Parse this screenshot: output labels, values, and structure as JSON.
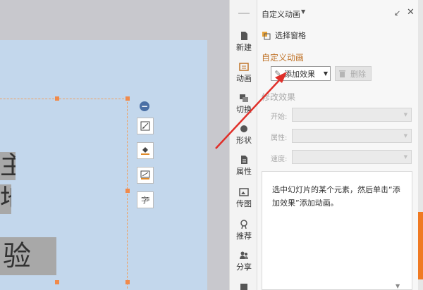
{
  "canvas": {
    "text_lines": [
      "主",
      "地",
      "验"
    ]
  },
  "toolstrip": {
    "items": [
      {
        "label": "新建",
        "icon": "new-doc-icon"
      },
      {
        "label": "动画",
        "icon": "animation-icon"
      },
      {
        "label": "切换",
        "icon": "transition-icon"
      },
      {
        "label": "形状",
        "icon": "shape-icon"
      },
      {
        "label": "属性",
        "icon": "properties-icon"
      },
      {
        "label": "传图",
        "icon": "upload-image-icon"
      },
      {
        "label": "推荐",
        "icon": "recommend-icon"
      },
      {
        "label": "分享",
        "icon": "share-icon"
      }
    ]
  },
  "panel": {
    "title": "自定义动画",
    "select_pane_label": "选择窗格",
    "section_heading": "自定义动画",
    "add_effect_label": "添加效果",
    "delete_label": "删除",
    "modify_heading": "修改效果",
    "fields": {
      "start_label": "开始:",
      "property_label": "属性:",
      "speed_label": "速度:"
    },
    "hint": "选中幻灯片的某个元素，然后单击“添加效果”添加动画。"
  },
  "colors": {
    "slide_bg": "#c3d7ec",
    "accent_orange": "#f07a22",
    "section_heading": "#c0742a",
    "arrow_red": "#e0302a"
  }
}
